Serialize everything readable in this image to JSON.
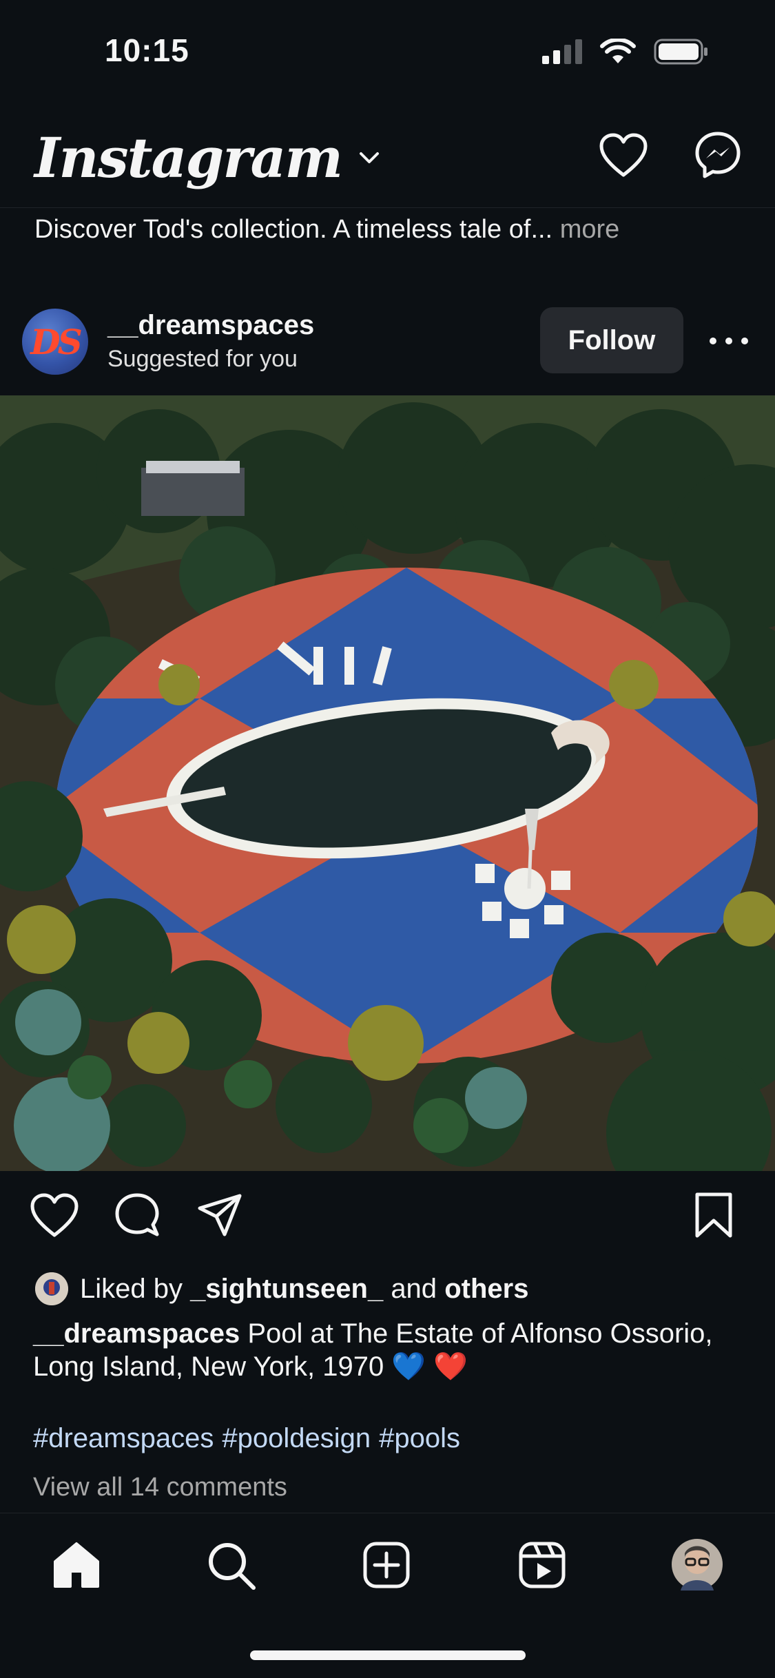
{
  "status_bar": {
    "time": "10:15",
    "signal_icon": "cellular-signal-icon",
    "wifi_icon": "wifi-icon",
    "battery_icon": "battery-icon"
  },
  "header": {
    "logo": "Instagram",
    "dropdown_icon": "chevron-down-icon",
    "actions": [
      "heart-icon",
      "messenger-icon"
    ]
  },
  "ad_banner": {
    "text": "Discover Tod's collection. A timeless tale of...",
    "more": "more"
  },
  "post": {
    "avatar_text": "DS",
    "username": "__dreamspaces",
    "subtitle": "Suggested for you",
    "follow_label": "Follow",
    "image_alt": "aerial view of oval pool with blue and red harlequin deck among evergreens",
    "likes": {
      "prefix": "Liked by",
      "user": "_sightunseen_",
      "joiner": "and",
      "others": "others"
    },
    "caption": {
      "username": "__dreamspaces",
      "text": "Pool at The Estate of Alfonso Ossorio, Long Island, New York, 1970 💙 ❤️"
    },
    "hashtags": [
      "#dreamspaces",
      "#pooldesign",
      "#pools"
    ],
    "view_comments": "View all 14 comments"
  },
  "actions": [
    "heart-icon",
    "comment-icon",
    "share-icon",
    "bookmark-icon"
  ],
  "nav": [
    "home-icon",
    "search-icon",
    "new-post-icon",
    "reels-icon",
    "profile-avatar"
  ],
  "colors": {
    "background": "#0c1014",
    "text": "#f5f5f5",
    "muted": "#a8a8a8",
    "hashtag": "#c3d9f5",
    "button": "#26292e"
  }
}
